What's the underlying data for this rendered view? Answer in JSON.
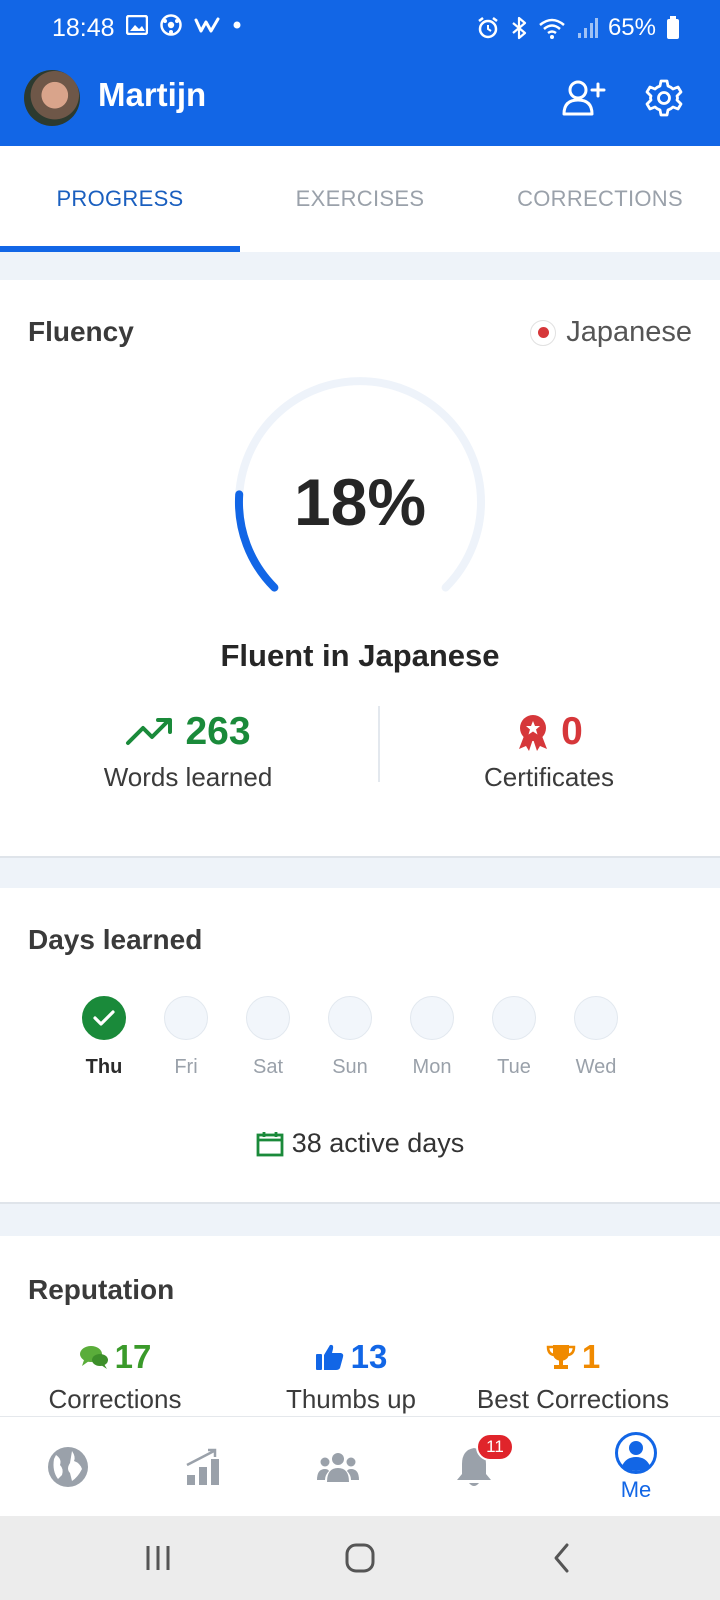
{
  "status_bar": {
    "time": "18:48",
    "battery": "65%",
    "left_icons": [
      "image-icon",
      "soccer-ball-icon",
      "w-app-icon",
      "dot-icon"
    ],
    "right_icons": [
      "alarm-icon",
      "bluetooth-icon",
      "wifi-icon",
      "signal-icon",
      "battery-icon"
    ]
  },
  "header": {
    "username": "Martijn",
    "actions": [
      "add-friend-icon",
      "settings-gear-icon"
    ]
  },
  "tabs": [
    {
      "label": "PROGRESS",
      "active": true
    },
    {
      "label": "EXERCISES",
      "active": false
    },
    {
      "label": "CORRECTIONS",
      "active": false
    }
  ],
  "fluency": {
    "title": "Fluency",
    "language": "Japanese",
    "percent_label": "18%",
    "percent": 18,
    "fluent_label": "Fluent in Japanese",
    "words_learned": {
      "value": "263",
      "label": "Words learned"
    },
    "certificates": {
      "value": "0",
      "label": "Certificates"
    }
  },
  "days_learned": {
    "title": "Days learned",
    "days": [
      {
        "label": "Thu",
        "done": true
      },
      {
        "label": "Fri",
        "done": false
      },
      {
        "label": "Sat",
        "done": false
      },
      {
        "label": "Sun",
        "done": false
      },
      {
        "label": "Mon",
        "done": false
      },
      {
        "label": "Tue",
        "done": false
      },
      {
        "label": "Wed",
        "done": false
      }
    ],
    "active_days": "38 active days"
  },
  "reputation": {
    "title": "Reputation",
    "corrections": {
      "value": "17",
      "label": "Corrections"
    },
    "thumbs_up": {
      "value": "13",
      "label": "Thumbs up"
    },
    "best_corrections": {
      "value": "1",
      "label": "Best Corrections"
    }
  },
  "bottom_nav": {
    "items": [
      "globe-icon",
      "chart-icon",
      "community-icon",
      "bell-icon",
      "me-icon"
    ],
    "notifications_badge": "11",
    "me_label": "Me"
  },
  "colors": {
    "brand_blue": "#1266e6",
    "tab_active": "#1a5fbf",
    "green": "#1a8a3a",
    "red": "#d6373a",
    "orange": "#f08a00"
  }
}
